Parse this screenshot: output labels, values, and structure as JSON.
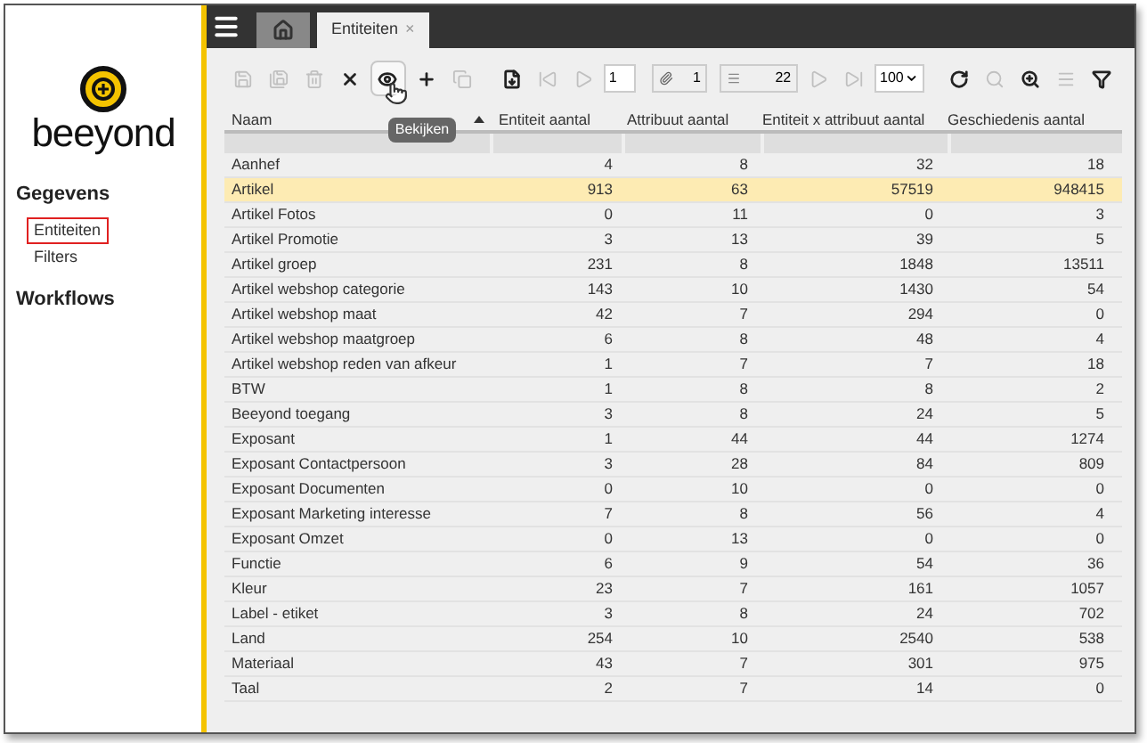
{
  "sidebar": {
    "logo_text": "beeyond",
    "sections": [
      {
        "title": "Gegevens",
        "items": [
          {
            "label": "Entiteiten",
            "selected": true
          },
          {
            "label": "Filters",
            "selected": false
          }
        ]
      },
      {
        "title": "Workflows"
      }
    ]
  },
  "tabs": [
    {
      "label": "Entiteiten",
      "selected": true,
      "close": "×"
    }
  ],
  "toolbar": {
    "page": "1",
    "selection_count": "1",
    "total": "22",
    "page_size": "100",
    "tooltip": "Bekijken"
  },
  "table": {
    "columns": [
      {
        "label": "Naam",
        "sorted": true
      },
      {
        "label": "Entiteit aantal",
        "sorted": false
      },
      {
        "label": "Attribuut aantal",
        "sorted": false
      },
      {
        "label": "Entiteit x attribuut aantal",
        "sorted": false
      },
      {
        "label": "Geschiedenis aantal",
        "sorted": false
      }
    ],
    "rows": [
      {
        "cells": [
          "Aanhef",
          "4",
          "8",
          "32",
          "18"
        ],
        "selected": false
      },
      {
        "cells": [
          "Artikel",
          "913",
          "63",
          "57519",
          "948415"
        ],
        "selected": true
      },
      {
        "cells": [
          "Artikel Fotos",
          "0",
          "11",
          "0",
          "3"
        ],
        "selected": false
      },
      {
        "cells": [
          "Artikel Promotie",
          "3",
          "13",
          "39",
          "5"
        ],
        "selected": false
      },
      {
        "cells": [
          "Artikel groep",
          "231",
          "8",
          "1848",
          "13511"
        ],
        "selected": false
      },
      {
        "cells": [
          "Artikel webshop categorie",
          "143",
          "10",
          "1430",
          "54"
        ],
        "selected": false
      },
      {
        "cells": [
          "Artikel webshop maat",
          "42",
          "7",
          "294",
          "0"
        ],
        "selected": false
      },
      {
        "cells": [
          "Artikel webshop maatgroep",
          "6",
          "8",
          "48",
          "4"
        ],
        "selected": false
      },
      {
        "cells": [
          "Artikel webshop reden van afkeur",
          "1",
          "7",
          "7",
          "18"
        ],
        "selected": false
      },
      {
        "cells": [
          "BTW",
          "1",
          "8",
          "8",
          "2"
        ],
        "selected": false
      },
      {
        "cells": [
          "Beeyond toegang",
          "3",
          "8",
          "24",
          "5"
        ],
        "selected": false
      },
      {
        "cells": [
          "Exposant",
          "1",
          "44",
          "44",
          "1274"
        ],
        "selected": false
      },
      {
        "cells": [
          "Exposant Contactpersoon",
          "3",
          "28",
          "84",
          "809"
        ],
        "selected": false
      },
      {
        "cells": [
          "Exposant Documenten",
          "0",
          "10",
          "0",
          "0"
        ],
        "selected": false
      },
      {
        "cells": [
          "Exposant Marketing interesse",
          "7",
          "8",
          "56",
          "4"
        ],
        "selected": false
      },
      {
        "cells": [
          "Exposant Omzet",
          "0",
          "13",
          "0",
          "0"
        ],
        "selected": false
      },
      {
        "cells": [
          "Functie",
          "6",
          "9",
          "54",
          "36"
        ],
        "selected": false
      },
      {
        "cells": [
          "Kleur",
          "23",
          "7",
          "161",
          "1057"
        ],
        "selected": false
      },
      {
        "cells": [
          "Label - etiket",
          "3",
          "8",
          "24",
          "702"
        ],
        "selected": false
      },
      {
        "cells": [
          "Land",
          "254",
          "10",
          "2540",
          "538"
        ],
        "selected": false
      },
      {
        "cells": [
          "Materiaal",
          "43",
          "7",
          "301",
          "975"
        ],
        "selected": false
      },
      {
        "cells": [
          "Taal",
          "2",
          "7",
          "14",
          "0"
        ],
        "selected": false
      }
    ]
  }
}
